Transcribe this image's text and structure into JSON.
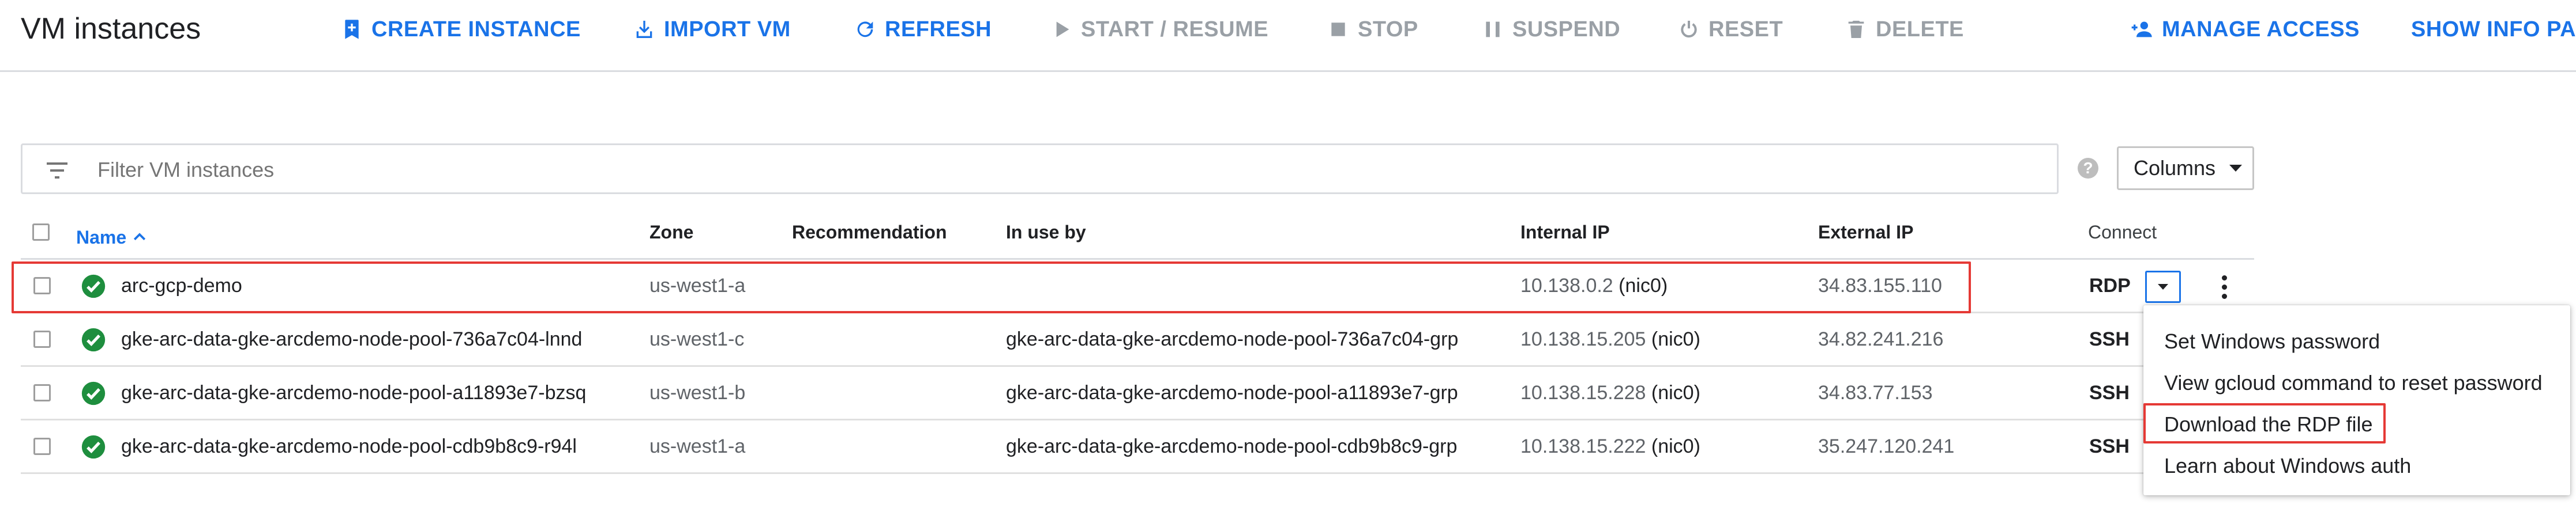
{
  "page": {
    "title": "VM instances"
  },
  "toolbar": {
    "create_instance": "CREATE INSTANCE",
    "import_vm": "IMPORT VM",
    "refresh": "REFRESH",
    "start_resume": "START / RESUME",
    "stop": "STOP",
    "suspend": "SUSPEND",
    "reset": "RESET",
    "delete": "DELETE",
    "manage_access": "MANAGE ACCESS",
    "show_info_panel": "SHOW INFO PAN"
  },
  "filter": {
    "placeholder": "Filter VM instances"
  },
  "columns_button": "Columns",
  "table": {
    "headers": {
      "name": "Name",
      "zone": "Zone",
      "recommendation": "Recommendation",
      "in_use_by": "In use by",
      "internal_ip": "Internal IP",
      "external_ip": "External IP",
      "connect": "Connect"
    },
    "rows": [
      {
        "name": "arc-gcp-demo",
        "zone": "us-west1-a",
        "recommendation": "",
        "in_use_by": "",
        "internal_ip": "10.138.0.2",
        "nic": "(nic0)",
        "external_ip": "34.83.155.110",
        "connect": "RDP"
      },
      {
        "name": "gke-arc-data-gke-arcdemo-node-pool-736a7c04-lnnd",
        "zone": "us-west1-c",
        "recommendation": "",
        "in_use_by": "gke-arc-data-gke-arcdemo-node-pool-736a7c04-grp",
        "internal_ip": "10.138.15.205",
        "nic": "(nic0)",
        "external_ip": "34.82.241.216",
        "connect": "SSH"
      },
      {
        "name": "gke-arc-data-gke-arcdemo-node-pool-a11893e7-bzsq",
        "zone": "us-west1-b",
        "recommendation": "",
        "in_use_by": "gke-arc-data-gke-arcdemo-node-pool-a11893e7-grp",
        "internal_ip": "10.138.15.228",
        "nic": "(nic0)",
        "external_ip": "34.83.77.153",
        "connect": "SSH"
      },
      {
        "name": "gke-arc-data-gke-arcdemo-node-pool-cdb9b8c9-r94l",
        "zone": "us-west1-a",
        "recommendation": "",
        "in_use_by": "gke-arc-data-gke-arcdemo-node-pool-cdb9b8c9-grp",
        "internal_ip": "10.138.15.222",
        "nic": "(nic0)",
        "external_ip": "35.247.120.241",
        "connect": "SSH"
      }
    ]
  },
  "rdp_menu": {
    "items": [
      "Set Windows password",
      "View gcloud command to reset password",
      "Download the RDP file",
      "Learn about Windows auth"
    ]
  },
  "colors": {
    "accent": "#1a73e8",
    "disabled": "#9aa0a6",
    "status_ok": "#1e8e3e",
    "highlight": "#e53935"
  },
  "icons": [
    "create-instance-icon",
    "import-vm-icon",
    "refresh-icon",
    "play-icon",
    "stop-icon",
    "pause-icon",
    "power-icon",
    "trash-icon",
    "add-person-icon",
    "filter-icon",
    "help-icon",
    "check-circle-icon",
    "sort-arrow-up-icon",
    "dropdown-caret-icon",
    "kebab-menu-icon"
  ]
}
